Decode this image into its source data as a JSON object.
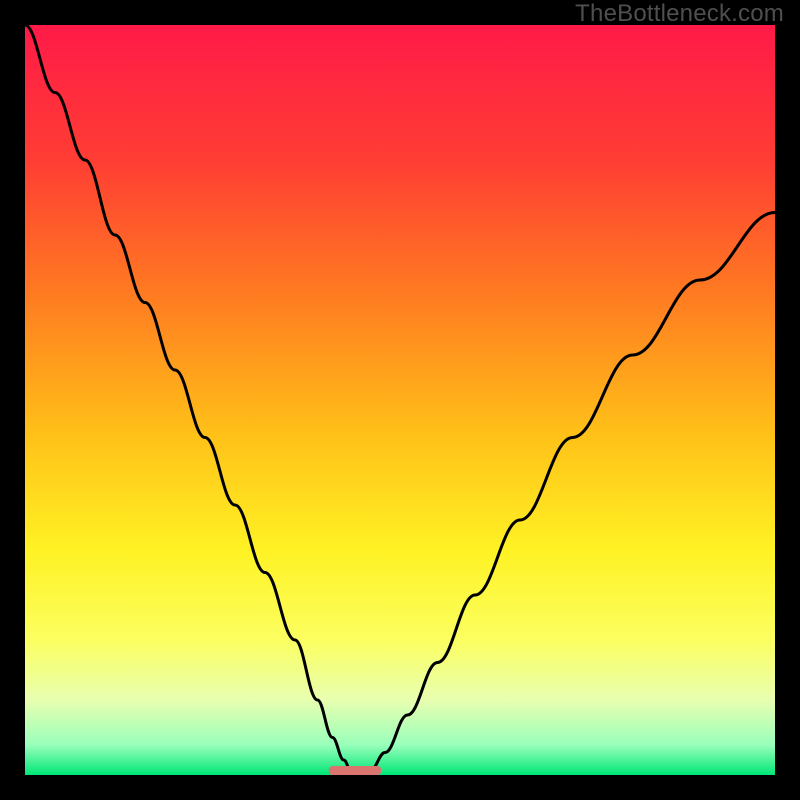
{
  "watermark": "TheBottleneck.com",
  "chart_data": {
    "type": "line",
    "title": "",
    "xlabel": "",
    "ylabel": "",
    "xlim": [
      0,
      100
    ],
    "ylim": [
      0,
      100
    ],
    "grid": false,
    "legend": false,
    "watermark": "TheBottleneck.com",
    "background": {
      "stops": [
        {
          "offset": 0.0,
          "color": "#ff1a48"
        },
        {
          "offset": 0.18,
          "color": "#ff3d34"
        },
        {
          "offset": 0.36,
          "color": "#ff7b21"
        },
        {
          "offset": 0.55,
          "color": "#ffc218"
        },
        {
          "offset": 0.7,
          "color": "#fff224"
        },
        {
          "offset": 0.82,
          "color": "#fbff60"
        },
        {
          "offset": 0.9,
          "color": "#e8ffb0"
        },
        {
          "offset": 0.96,
          "color": "#99ffbb"
        },
        {
          "offset": 1.0,
          "color": "#00e676"
        }
      ]
    },
    "marker": {
      "x": 44,
      "y": 0,
      "width": 7,
      "height": 1.2,
      "color": "#d9746f"
    },
    "series": [
      {
        "name": "left-curve",
        "color": "#000000",
        "x": [
          0,
          4,
          8,
          12,
          16,
          20,
          24,
          28,
          32,
          36,
          39,
          41,
          42.5,
          43.5
        ],
        "y": [
          100,
          91,
          82,
          72,
          63,
          54,
          45,
          36,
          27,
          18,
          10,
          5,
          2,
          0.5
        ]
      },
      {
        "name": "right-curve",
        "color": "#000000",
        "x": [
          46,
          48,
          51,
          55,
          60,
          66,
          73,
          81,
          90,
          100
        ],
        "y": [
          0.5,
          3,
          8,
          15,
          24,
          34,
          45,
          56,
          66,
          75
        ]
      }
    ]
  }
}
